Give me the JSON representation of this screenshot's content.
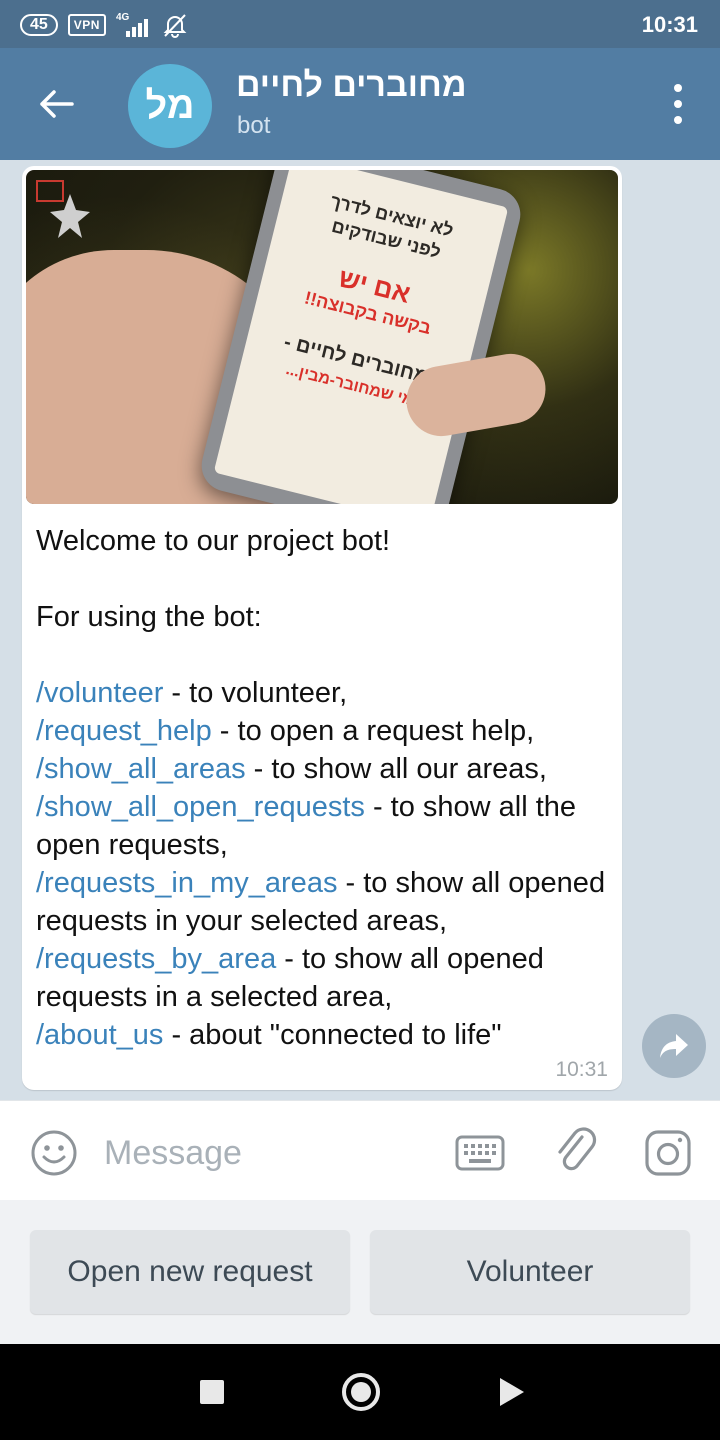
{
  "status_bar": {
    "battery": "45",
    "vpn": "VPN",
    "network": "4G",
    "clock": "10:31"
  },
  "header": {
    "avatar_initials": "מל",
    "title": "מחוברים לחיים",
    "subtitle": "bot"
  },
  "message": {
    "image_text": {
      "line1": "לא יוצאים לדרך",
      "line2": "לפני שבודקים",
      "line3": "אם יש",
      "line4": "בקשה בקבוצה!!",
      "line5": "מחוברים לחיים -",
      "line6": "מי שמחובר-מבין..."
    },
    "welcome": "Welcome to our project bot!",
    "usage": "For using the bot:",
    "commands": [
      {
        "cmd": "/volunteer",
        "desc": " - to volunteer,"
      },
      {
        "cmd": "/request_help",
        "desc": " - to open a request help,"
      },
      {
        "cmd": "/show_all_areas",
        "desc": " - to show all our areas,"
      },
      {
        "cmd": "/show_all_open_requests",
        "desc": " - to show all the open requests,"
      },
      {
        "cmd": "/requests_in_my_areas",
        "desc": " - to show all opened requests in your selected areas,"
      },
      {
        "cmd": "/requests_by_area",
        "desc": " - to show all opened requests in a selected area,"
      },
      {
        "cmd": "/about_us",
        "desc": " - about \"connected to life\""
      }
    ],
    "time": "10:31"
  },
  "input": {
    "placeholder": "Message"
  },
  "keyboard": {
    "open_request": "Open new request",
    "volunteer": "Volunteer"
  },
  "icons": {
    "back": "arrow-back-icon",
    "menu": "more-vertical-icon",
    "share": "share-arrow-icon",
    "emoji": "emoji-icon",
    "keyboard": "keyboard-icon",
    "attach": "paperclip-icon",
    "camera": "camera-icon"
  },
  "colors": {
    "header": "#527da3",
    "status_bar": "#4c6f8e",
    "link": "#3a82ba",
    "avatar": "#5bb5d8"
  }
}
